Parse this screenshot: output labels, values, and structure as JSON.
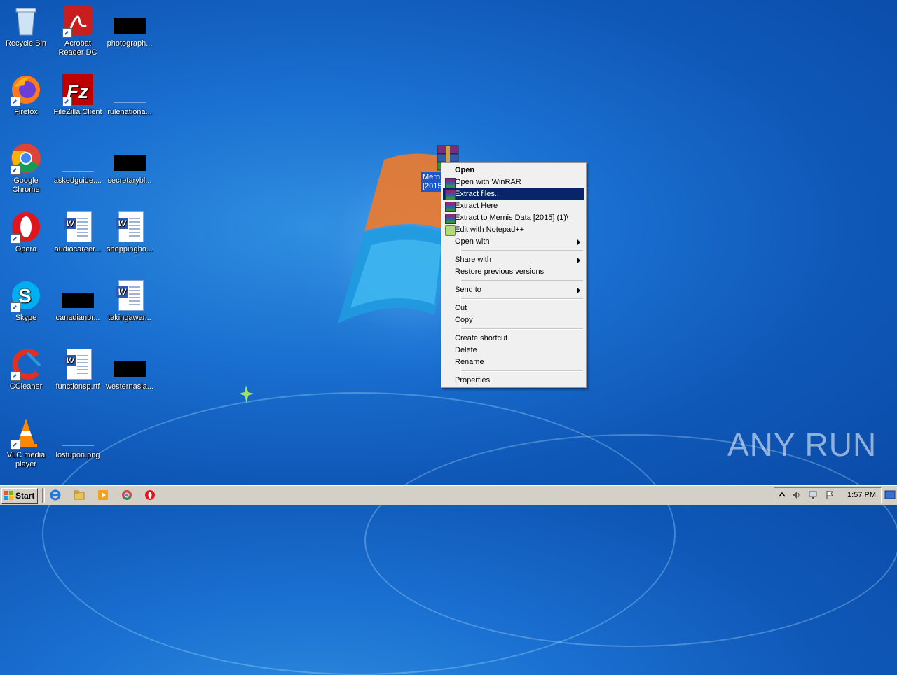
{
  "desktop": {
    "icons": [
      {
        "label": "Recycle Bin"
      },
      {
        "label": "Acrobat Reader DC"
      },
      {
        "label": "photograph..."
      },
      {
        "label": "Firefox"
      },
      {
        "label": "FileZilla Client"
      },
      {
        "label": "rulenationa..."
      },
      {
        "label": "Google Chrome"
      },
      {
        "label": "askedguide...."
      },
      {
        "label": "secretarybl..."
      },
      {
        "label": "Opera"
      },
      {
        "label": "audiocareer..."
      },
      {
        "label": "shoppingho..."
      },
      {
        "label": "Skype"
      },
      {
        "label": "canadianbr..."
      },
      {
        "label": "takingawar..."
      },
      {
        "label": "CCleaner"
      },
      {
        "label": "functionsp.rtf"
      },
      {
        "label": "westernasia..."
      },
      {
        "label": "VLC media player"
      },
      {
        "label": "lostupon.png"
      }
    ],
    "selected_file": {
      "line1": "Mern",
      "line2": "[2015"
    }
  },
  "context_menu": {
    "items": [
      {
        "label": "Open"
      },
      {
        "label": "Open with WinRAR"
      },
      {
        "label": "Extract files..."
      },
      {
        "label": "Extract Here"
      },
      {
        "label": "Extract to Mernis Data [2015] (1)\\"
      },
      {
        "label": "Edit with Notepad++"
      },
      {
        "label": "Open with"
      },
      {
        "label": "Share with"
      },
      {
        "label": "Restore previous versions"
      },
      {
        "label": "Send to"
      },
      {
        "label": "Cut"
      },
      {
        "label": "Copy"
      },
      {
        "label": "Create shortcut"
      },
      {
        "label": "Delete"
      },
      {
        "label": "Rename"
      },
      {
        "label": "Properties"
      }
    ],
    "highlighted": "Extract files...",
    "highlight_color": "#0a246a"
  },
  "taskbar": {
    "start_label": "Start",
    "clock": "1:57 PM",
    "quick_launch": [
      "internet-explorer-icon",
      "explorer-folder-icon",
      "media-player-icon",
      "chrome-icon",
      "opera-icon"
    ]
  },
  "watermark": {
    "text": "ANY RUN"
  }
}
